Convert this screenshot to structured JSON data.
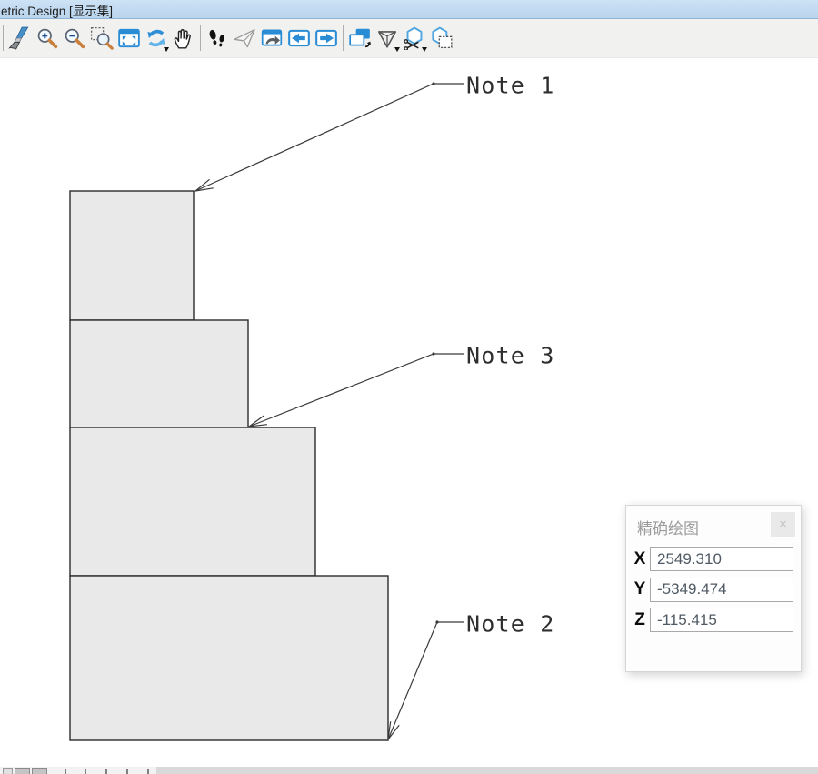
{
  "titlebar": {
    "title": "etric Design [显示集]"
  },
  "toolbar": {
    "buttons": [
      {
        "name": "update-view",
        "icon": "paintbrush-icon"
      },
      {
        "name": "zoom-in",
        "icon": "zoom-in-icon"
      },
      {
        "name": "zoom-out",
        "icon": "zoom-out-icon"
      },
      {
        "name": "window-area",
        "icon": "window-area-icon"
      },
      {
        "name": "fit-view",
        "icon": "fit-view-icon"
      },
      {
        "name": "rotate-view",
        "icon": "rotate-view-icon",
        "has_dropdown": true
      },
      {
        "name": "pan-view",
        "icon": "pan-hand-icon"
      },
      {
        "name": "walk",
        "icon": "footprints-icon"
      },
      {
        "name": "fly",
        "icon": "paper-plane-icon"
      },
      {
        "name": "view-history",
        "icon": "window-back-arrow-icon"
      },
      {
        "name": "view-previous",
        "icon": "arrow-left-icon"
      },
      {
        "name": "view-next",
        "icon": "arrow-right-icon"
      },
      {
        "name": "copy-view",
        "icon": "copy-windows-icon"
      },
      {
        "name": "display-style",
        "icon": "wireframe-pyramid-icon",
        "has_dropdown": true
      },
      {
        "name": "clip-volume",
        "icon": "hexagon-scissors-icon",
        "has_dropdown": true
      },
      {
        "name": "clip-mask",
        "icon": "hexagon-mask-icon"
      }
    ]
  },
  "canvas": {
    "notes": [
      {
        "label": "Note 1"
      },
      {
        "label": "Note 3"
      },
      {
        "label": "Note 2"
      }
    ]
  },
  "accudraw": {
    "title": "精确绘图",
    "close_label": "×",
    "fields": [
      {
        "label": "X",
        "value": "2549.310"
      },
      {
        "label": "Y",
        "value": "-5349.474"
      },
      {
        "label": "Z",
        "value": "-115.415"
      }
    ]
  },
  "colors": {
    "accent_blue": "#2a8cd4",
    "shape_fill": "#e9e9e9",
    "shape_stroke": "#2b2b2b",
    "titlebar_blue": "#c2daf0"
  }
}
